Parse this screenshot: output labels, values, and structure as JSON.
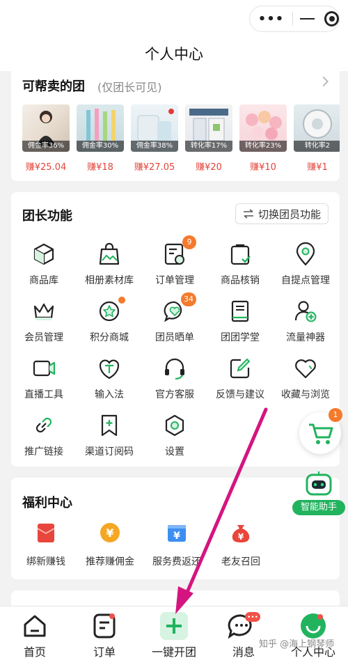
{
  "window": {
    "title": "个人中心",
    "capsule_more": "•••"
  },
  "sellable_groups": {
    "title": "可帮卖的团",
    "subtitle": "(仅团长可见)",
    "products": [
      {
        "rate": "佣金率36%",
        "earn": "赚¥25.04"
      },
      {
        "rate": "佣金率30%",
        "earn": "赚¥18"
      },
      {
        "rate": "佣金率38%",
        "earn": "赚¥27.05"
      },
      {
        "rate": "转化率17%",
        "earn": "赚¥20"
      },
      {
        "rate": "转化率23%",
        "earn": "赚¥10"
      },
      {
        "rate": "转化率2",
        "earn": "赚¥1"
      }
    ]
  },
  "leader_functions": {
    "title": "团长功能",
    "switch_label": "切换团员功能",
    "items": [
      {
        "label": "商品库",
        "icon": "cube-icon"
      },
      {
        "label": "相册素材库",
        "icon": "album-bag-icon"
      },
      {
        "label": "订单管理",
        "icon": "order-doc-icon",
        "badge": "9"
      },
      {
        "label": "商品核销",
        "icon": "bag-check-icon"
      },
      {
        "label": "自提点管理",
        "icon": "location-pin-icon"
      },
      {
        "label": "会员管理",
        "icon": "crown-icon"
      },
      {
        "label": "积分商城",
        "icon": "star-badge-icon"
      },
      {
        "label": "团员晒单",
        "icon": "chat-heart-icon",
        "badge": "34"
      },
      {
        "label": "团团学堂",
        "icon": "book-icon"
      },
      {
        "label": "流量神器",
        "icon": "user-add-icon"
      },
      {
        "label": "直播工具",
        "icon": "video-camera-icon"
      },
      {
        "label": "输入法",
        "icon": "text-input-icon"
      },
      {
        "label": "官方客服",
        "icon": "headset-icon"
      },
      {
        "label": "反馈与建议",
        "icon": "edit-icon"
      },
      {
        "label": "收藏与浏览",
        "icon": "heart-icon"
      },
      {
        "label": "推广链接",
        "icon": "link-icon"
      },
      {
        "label": "渠道订阅码",
        "icon": "bookmark-plus-icon"
      },
      {
        "label": "设置",
        "icon": "settings-hexagon-icon"
      }
    ]
  },
  "welfare": {
    "title": "福利中心",
    "items": [
      {
        "label": "绑新赚钱",
        "icon": "red-envelope-icon",
        "color": "#e8453c"
      },
      {
        "label": "推荐赚佣金",
        "icon": "yuan-coin-icon",
        "color": "#f5a623"
      },
      {
        "label": "服务费返还",
        "icon": "yuan-ticket-icon",
        "color": "#3d8ef0"
      },
      {
        "label": "老友召回",
        "icon": "money-bag-icon",
        "color": "#e8453c"
      }
    ]
  },
  "floating": {
    "cart_badge": "1",
    "assistant_label": "智能助手"
  },
  "tabbar": {
    "items": [
      {
        "label": "首页",
        "icon": "home-icon"
      },
      {
        "label": "订单",
        "icon": "order-list-icon"
      },
      {
        "label": "一键开团",
        "icon": "plus-icon"
      },
      {
        "label": "消息",
        "icon": "message-icon",
        "badge": "•••"
      },
      {
        "label": "个人中心",
        "icon": "profile-icon"
      }
    ]
  },
  "watermark": "知乎 @海上钢琴师",
  "colors": {
    "accent_green": "#22b35e",
    "badge_orange": "#f47a2c",
    "price_red": "#e4443a",
    "arrow_magenta": "#d4157f"
  }
}
